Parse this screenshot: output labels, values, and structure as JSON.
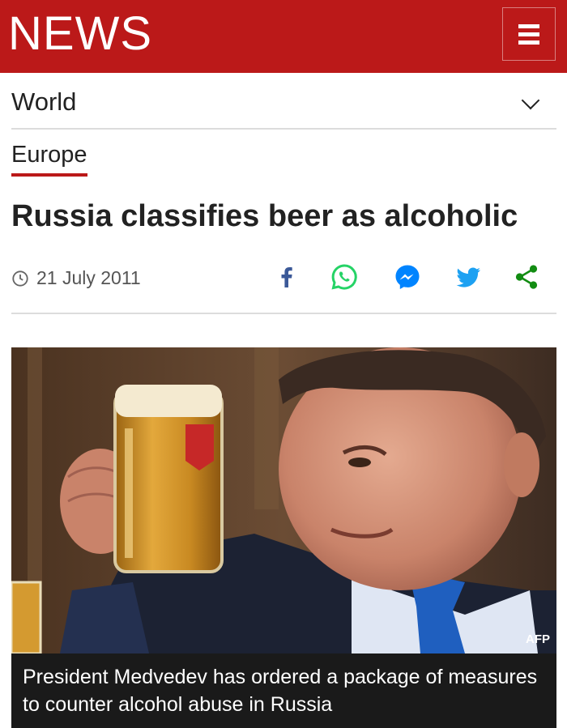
{
  "header": {
    "brand": "NEWS",
    "menu_icon": "hamburger-menu-icon",
    "color": "#bb1919"
  },
  "nav": {
    "section": "World",
    "toggle_icon": "chevron-down-icon",
    "subsection": "Europe"
  },
  "article": {
    "headline": "Russia classifies beer as alcoholic",
    "date": "21 July 2011",
    "date_icon": "clock-icon"
  },
  "share": {
    "items": [
      {
        "name": "facebook",
        "icon": "facebook-icon",
        "color": "#3b5998"
      },
      {
        "name": "whatsapp",
        "icon": "whatsapp-icon",
        "color": "#25d366"
      },
      {
        "name": "messenger",
        "icon": "messenger-icon",
        "color": "#0084ff"
      },
      {
        "name": "twitter",
        "icon": "twitter-icon",
        "color": "#1da1f2"
      },
      {
        "name": "share",
        "icon": "share-icon",
        "color": "#128c12"
      }
    ]
  },
  "image": {
    "credit": "AFP",
    "caption": "President Medvedev has ordered a package of measures to counter alcohol abuse in Russia"
  }
}
